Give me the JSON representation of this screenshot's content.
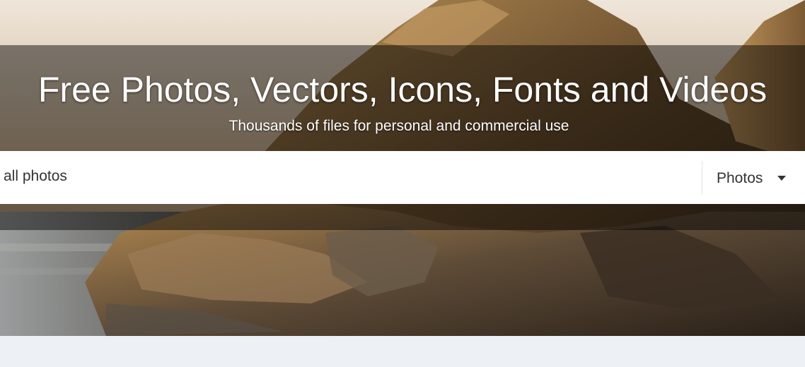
{
  "hero": {
    "title": "Free Photos, Vectors, Icons, Fonts and Videos",
    "subtitle": "Thousands of files for personal and commercial use"
  },
  "search": {
    "value": "all photos",
    "placeholder": "all photos",
    "type_selected": "Photos",
    "type_icon": "caret-down-icon"
  },
  "colors": {
    "page_background": "#edf1f5",
    "search_background": "#ffffff",
    "text_dark": "#333333"
  }
}
